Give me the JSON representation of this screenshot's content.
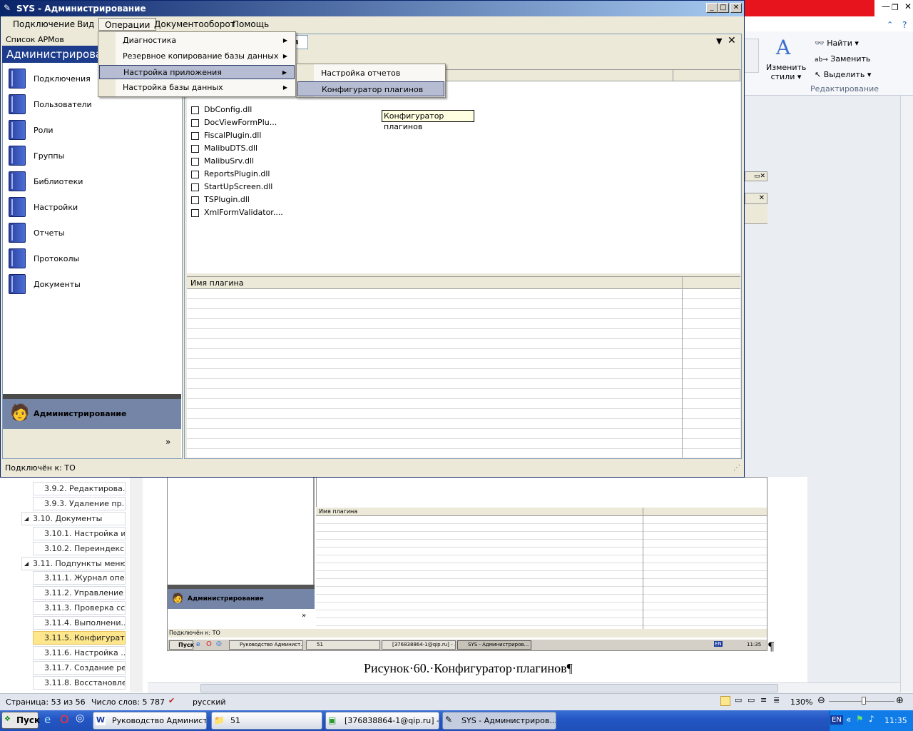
{
  "app": {
    "title": "SYS - Администрирование",
    "menu": [
      "Подключение",
      "Вид",
      "Операции",
      "Документооборот",
      "Помощь"
    ],
    "left_panel": {
      "caption": "Список АРМов",
      "header": "Администрирование",
      "items": [
        "Подключения",
        "Пользователи",
        "Роли",
        "Группы",
        "Библиотеки",
        "Настройки",
        "Отчеты",
        "Протоколы",
        "Документы"
      ],
      "footer": "Администрирование",
      "expand": "»"
    },
    "tab_fragment": "ов",
    "plugins": [
      "DbConfig.dll",
      "DocViewFormPlu...",
      "FiscalPlugin.dll",
      "MalibuDTS.dll",
      "MalibuSrv.dll",
      "ReportsPlugin.dll",
      "StartUpScreen.dll",
      "TSPlugin.dll",
      "XmlFormValidator...."
    ],
    "grid_header": "Имя плагина",
    "status": "Подключён к: ТО",
    "operations_menu": [
      {
        "label": "Диагностика",
        "submenu": true
      },
      {
        "label": "Резервное копирование базы данных",
        "submenu": true
      },
      {
        "label": "Настройка приложения",
        "submenu": true
      },
      {
        "label": "Настройка базы данных",
        "submenu": true
      }
    ],
    "app_settings_submenu": [
      "Настройка отчетов",
      "Конфигуратор плагинов"
    ],
    "tooltip": "Конфигуратор плагинов"
  },
  "word": {
    "ribbon": {
      "change_styles": [
        "Изменить",
        "стили"
      ],
      "find": "Найти",
      "replace": "Заменить",
      "select": "Выделить",
      "group": "Редактирование"
    },
    "nav": [
      {
        "label": "3.9.2. Редактирова...",
        "level": 2
      },
      {
        "label": "3.9.3. Удаление пр...",
        "level": 2
      },
      {
        "label": "3.10.  Документы",
        "level": 1
      },
      {
        "label": "3.10.1. Настройка и...",
        "level": 2
      },
      {
        "label": "3.10.2. Переиндекс...",
        "level": 2
      },
      {
        "label": "3.11. Подпункты меню...",
        "level": 1
      },
      {
        "label": "3.11.1. Журнал опе...",
        "level": 2
      },
      {
        "label": "3.11.2. Управление ...",
        "level": 2
      },
      {
        "label": "3.11.3. Проверка сс...",
        "level": 2
      },
      {
        "label": "3.11.4. Выполнени...",
        "level": 2
      },
      {
        "label": "3.11.5. Конфигурат...",
        "level": 2,
        "selected": true
      },
      {
        "label": "3.11.6. Настройка ...",
        "level": 2
      },
      {
        "label": "3.11.7. Создание ре...",
        "level": 2
      },
      {
        "label": "3.11.8. Восстановле...",
        "level": 2
      }
    ],
    "caption": "Рисунок·60.·Конфигуратор·плагинов¶",
    "inner": {
      "grid_header": "Имя плагина",
      "admin": "Администрирование",
      "status": "Подключён к: ТО",
      "taskbar": {
        "start": "Пуск",
        "items": [
          "Руководство Админист...",
          "51",
          "[376838864-1@qip.ru] - ...",
          "SYS - Администриров..."
        ],
        "lang": "EN",
        "time": "11:35"
      },
      "pilcrow": "¶"
    },
    "status": {
      "page": "Страница: 53 из 56",
      "words": "Число слов: 5 787",
      "lang": "русский",
      "zoom": "130%"
    }
  },
  "taskbar": {
    "start": "Пуск",
    "items": [
      "Руководство Админист...",
      "51",
      "[376838864-1@qip.ru] - ...",
      "SYS - Администриров..."
    ],
    "lang": "EN",
    "time": "11:35"
  }
}
